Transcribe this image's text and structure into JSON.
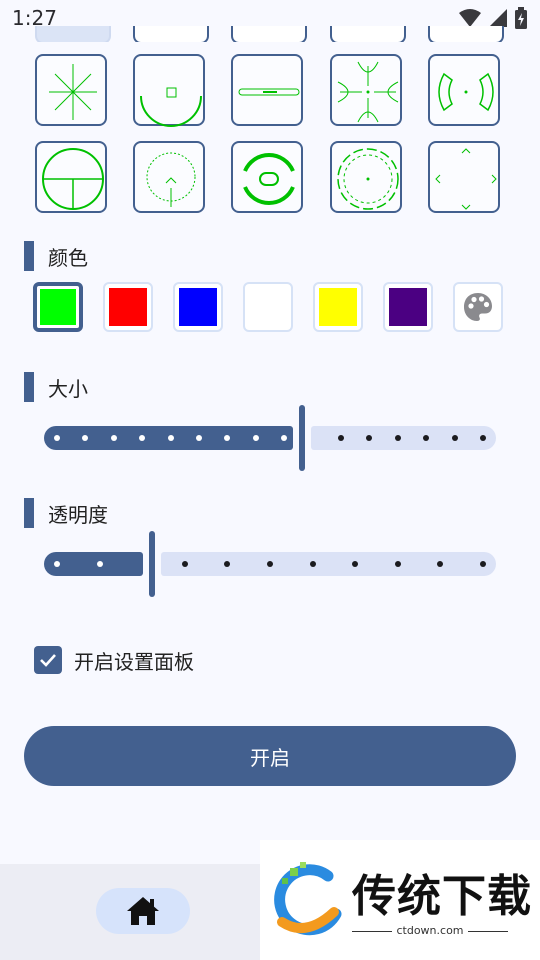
{
  "status_bar": {
    "time": "1:27",
    "icons": [
      "wifi-icon",
      "signal-icon",
      "battery-charging-icon"
    ]
  },
  "reticles": {
    "accent_color": "#00c000",
    "items": [
      "starburst",
      "arc-with-square",
      "horizontal-level",
      "sniper-cross",
      "bracket-circle",
      "crosshair-circle",
      "chevron-circle",
      "bold-ring",
      "dotted-ring",
      "corner-chevrons"
    ]
  },
  "color_section": {
    "title": "颜色",
    "selected": "green",
    "swatches": [
      {
        "name": "green",
        "hex": "#00ff00"
      },
      {
        "name": "red",
        "hex": "#ff0000"
      },
      {
        "name": "blue",
        "hex": "#0000ff"
      },
      {
        "name": "white",
        "hex": "#ffffff"
      },
      {
        "name": "yellow",
        "hex": "#ffff00"
      },
      {
        "name": "purple",
        "hex": "#4b0082"
      }
    ],
    "custom_icon": "palette-icon"
  },
  "size_section": {
    "title": "大小",
    "value_fraction": 0.57,
    "steps": 15
  },
  "opacity_section": {
    "title": "透明度",
    "value_fraction": 0.24,
    "steps": 10
  },
  "settings_panel": {
    "label": "开启设置面板",
    "checked": true
  },
  "start_button": {
    "label": "开启"
  },
  "bottom_nav": {
    "home_icon": "home-icon"
  },
  "watermark": {
    "title": "传统下载",
    "domain": "ctdown.com"
  },
  "colors": {
    "primary": "#43608f",
    "track_inactive": "#dbe2f6",
    "background": "#f8f9ff"
  }
}
